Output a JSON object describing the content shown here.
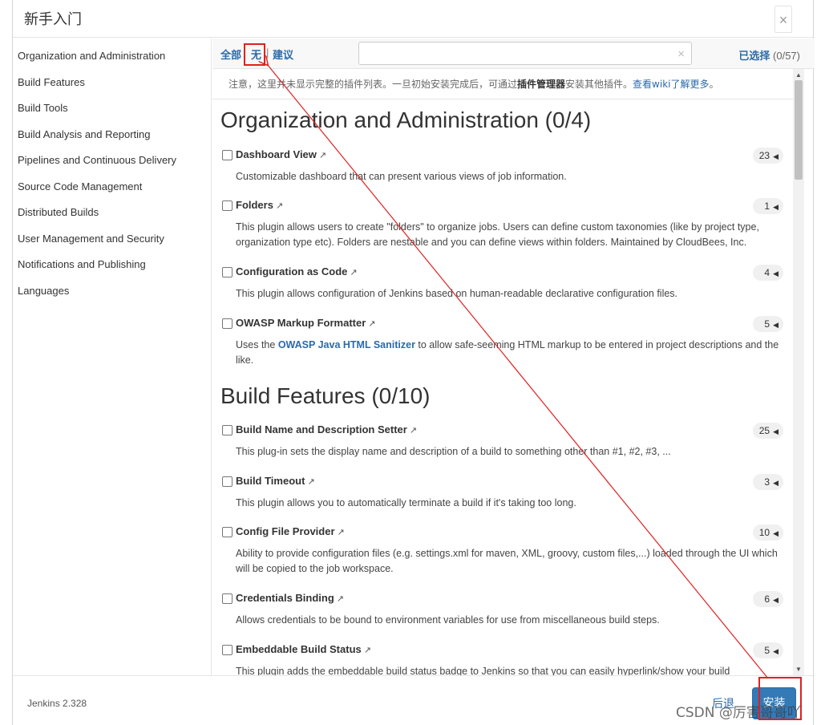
{
  "header": {
    "title": "新手入门",
    "close_glyph": "×"
  },
  "sidebar": {
    "items": [
      "Organization and Administration",
      "Build Features",
      "Build Tools",
      "Build Analysis and Reporting",
      "Pipelines and Continuous Delivery",
      "Source Code Management",
      "Distributed Builds",
      "User Management and Security",
      "Notifications and Publishing",
      "Languages"
    ]
  },
  "toolbar": {
    "all_label": "全部",
    "none_label": "无",
    "suggested_label": "建议",
    "separator": "|",
    "search_value": "",
    "clear_glyph": "×",
    "selected_label": "已选择",
    "selected_count": "(0/57)"
  },
  "notice": {
    "prefix": "注意，这里并未显示完整的插件列表。一旦初始安装完成后，可通过",
    "bold": "插件管理器",
    "middle": "安装其他插件。",
    "link": "查看wiki了解更多",
    "suffix": "。"
  },
  "categories": [
    {
      "title": "Organization and Administration (0/4)",
      "plugins": [
        {
          "name": "Dashboard View",
          "count": "23",
          "desc": "Customizable dashboard that can present various views of job information."
        },
        {
          "name": "Folders",
          "count": "1",
          "desc": "This plugin allows users to create \"folders\" to organize jobs. Users can define custom taxonomies (like by project type, organization type etc). Folders are nestable and you can define views within folders. Maintained by CloudBees, Inc."
        },
        {
          "name": "Configuration as Code",
          "count": "4",
          "desc": "This plugin allows configuration of Jenkins based on human-readable declarative configuration files."
        },
        {
          "name": "OWASP Markup Formatter",
          "count": "5",
          "desc_pre": "Uses the ",
          "desc_link": "OWASP Java HTML Sanitizer",
          "desc_post": " to allow safe-seeming HTML markup to be entered in project descriptions and the like."
        }
      ]
    },
    {
      "title": "Build Features (0/10)",
      "plugins": [
        {
          "name": "Build Name and Description Setter",
          "count": "25",
          "desc": "This plug-in sets the display name and description of a build to something other than #1, #2, #3, ..."
        },
        {
          "name": "Build Timeout",
          "count": "3",
          "desc": "This plugin allows you to automatically terminate a build if it's taking too long."
        },
        {
          "name": "Config File Provider",
          "count": "10",
          "desc": "Ability to provide configuration files (e.g. settings.xml for maven, XML, groovy, custom files,...) loaded through the UI which will be copied to the job workspace."
        },
        {
          "name": "Credentials Binding",
          "count": "6",
          "desc": "Allows credentials to be bound to environment variables for use from miscellaneous build steps."
        },
        {
          "name": "Embeddable Build Status",
          "count": "5",
          "desc": "This plugin adds the embeddable build status badge to Jenkins so that you can easily hyperlink/show your build"
        }
      ]
    }
  ],
  "icons": {
    "external": "↗",
    "caret": "◀",
    "scroll_up": "▲",
    "scroll_down": "▼"
  },
  "footer": {
    "version": "Jenkins 2.328",
    "back_label": "后退",
    "install_label": "安装"
  },
  "watermark": "CSDN @厉害哥哥吖",
  "colors": {
    "link": "#2b6aa8",
    "primary_button": "#337ab7",
    "annotation": "#e02020"
  }
}
